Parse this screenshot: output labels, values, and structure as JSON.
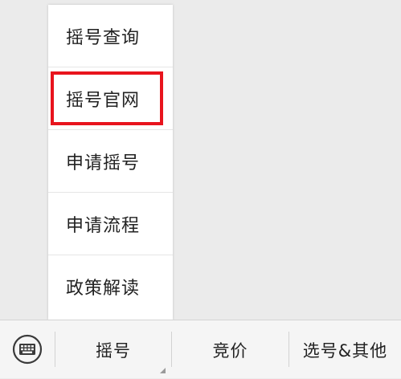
{
  "popup_menu": {
    "items": [
      {
        "label": "摇号查询"
      },
      {
        "label": "摇号官网"
      },
      {
        "label": "申请摇号"
      },
      {
        "label": "申请流程"
      },
      {
        "label": "政策解读"
      }
    ],
    "highlighted_index": 1,
    "highlight_color": "#e8141d"
  },
  "bottom_bar": {
    "keyboard_icon": "keyboard-icon",
    "tabs": [
      {
        "label": "摇号"
      },
      {
        "label": "竞价"
      },
      {
        "label": "选号&其他"
      }
    ]
  }
}
